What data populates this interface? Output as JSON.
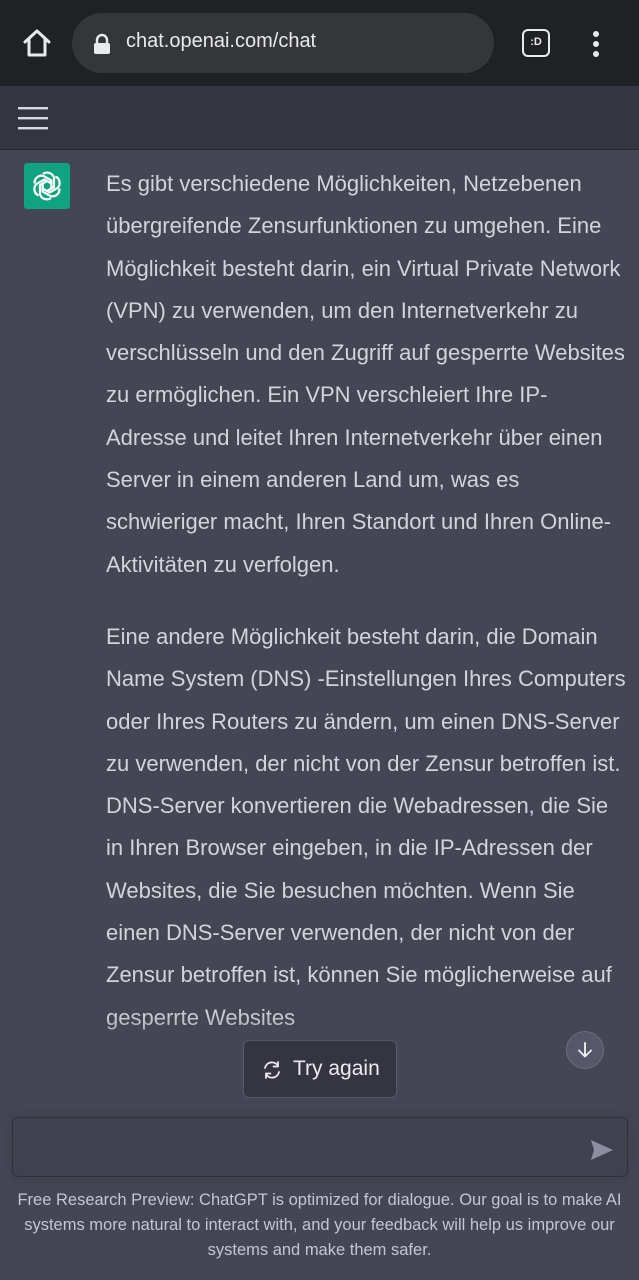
{
  "browser": {
    "url": "chat.openai.com/chat",
    "tab_count_label": ":D"
  },
  "header": {},
  "message": {
    "paragraphs": [
      "Es gibt verschiedene Möglichkeiten, Netzebenen übergreifende Zensurfunktionen zu umgehen. Eine Möglichkeit besteht darin, ein Virtual Private Network (VPN) zu verwenden, um den Internetverkehr zu verschlüsseln und den Zugriff auf gesperrte Websites zu ermöglichen. Ein VPN verschleiert Ihre IP-Adresse und leitet Ihren Internetverkehr über einen Server in einem anderen Land um, was es schwieriger macht, Ihren Standort und Ihren Online-Aktivitäten zu verfolgen.",
      "Eine andere Möglichkeit besteht darin, die Domain Name System (DNS) -Einstellungen Ihres Computers oder Ihres Routers zu ändern, um einen DNS-Server zu verwenden, der nicht von der Zensur betroffen ist. DNS-Server konvertieren die Webadressen, die Sie in Ihren Browser eingeben, in die IP-Adressen der Websites, die Sie besuchen möchten. Wenn Sie einen DNS-Server verwenden, der nicht von der Zensur betroffen ist, können Sie möglicherweise auf gesperrte Websites"
    ]
  },
  "actions": {
    "try_again_label": "Try again"
  },
  "composer": {
    "value": "",
    "placeholder": ""
  },
  "footer": {
    "text": "Free Research Preview: ChatGPT is optimized for dialogue. Our goal is to make AI systems more natural to interact with, and your feedback will help us improve our systems and make them safer."
  },
  "colors": {
    "accent": "#10a37f",
    "chat_bg": "#444654",
    "header_bg": "#343541",
    "browser_bg": "#202124"
  }
}
